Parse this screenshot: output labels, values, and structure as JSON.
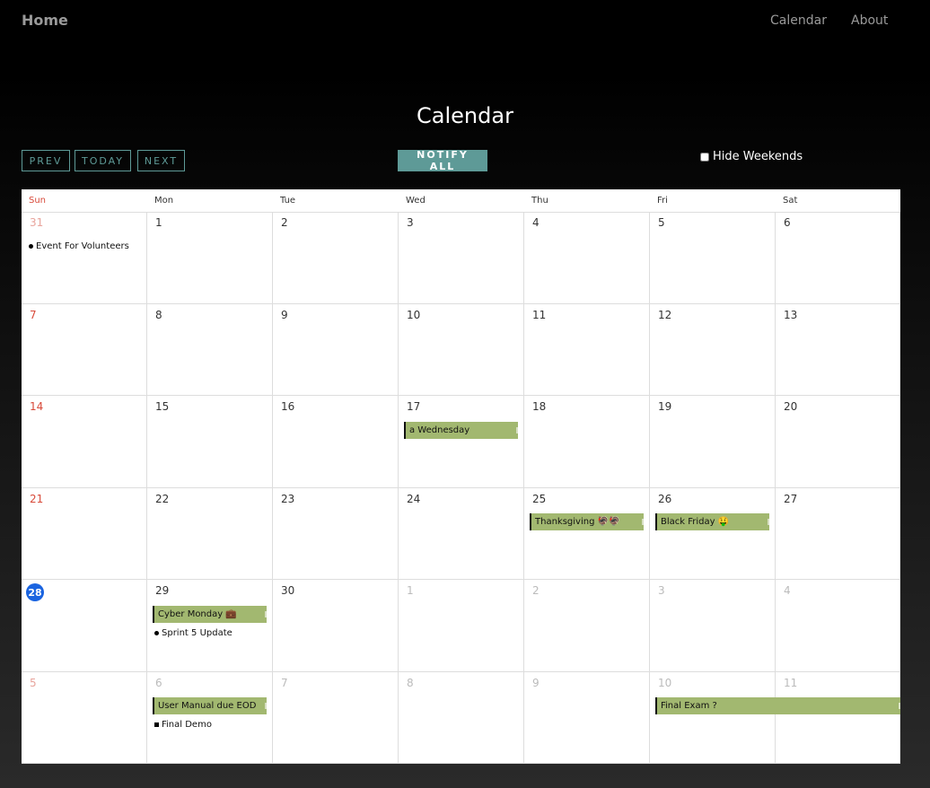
{
  "nav": {
    "home": "Home",
    "links": [
      "Calendar",
      "About"
    ]
  },
  "page_title": "Calendar",
  "toolbar": {
    "prev": "PREV",
    "today": "TODAY",
    "next": "NEXT",
    "notify_all": "NOTIFY ALL",
    "hide_weekends": "Hide Weekends"
  },
  "weekdays": [
    "Sun",
    "Mon",
    "Tue",
    "Wed",
    "Thu",
    "Fri",
    "Sat"
  ],
  "weeks": [
    [
      "31",
      "1",
      "2",
      "3",
      "4",
      "5",
      "6"
    ],
    [
      "7",
      "8",
      "9",
      "10",
      "11",
      "12",
      "13"
    ],
    [
      "14",
      "15",
      "16",
      "17",
      "18",
      "19",
      "20"
    ],
    [
      "21",
      "22",
      "23",
      "24",
      "25",
      "26",
      "27"
    ],
    [
      "28",
      "29",
      "30",
      "1",
      "2",
      "3",
      "4"
    ],
    [
      "5",
      "6",
      "7",
      "8",
      "9",
      "10",
      "11"
    ]
  ],
  "events": {
    "event_for_volunteers": "Event For Volunteers",
    "a_wednesday": "a Wednesday",
    "thanksgiving": "Thanksgiving 🦃🦃",
    "black_friday": "Black Friday 🤑",
    "cyber_monday": "Cyber Monday 💼",
    "sprint_5_update": "Sprint 5 Update",
    "user_manual": "User Manual due EOD",
    "final_demo": "Final Demo",
    "final_exam": "Final Exam ?"
  },
  "colors": {
    "accent": "#5e9a97",
    "event_bar": "#a2b870",
    "today": "#1a64e0",
    "sunday": "#d84a3a"
  }
}
